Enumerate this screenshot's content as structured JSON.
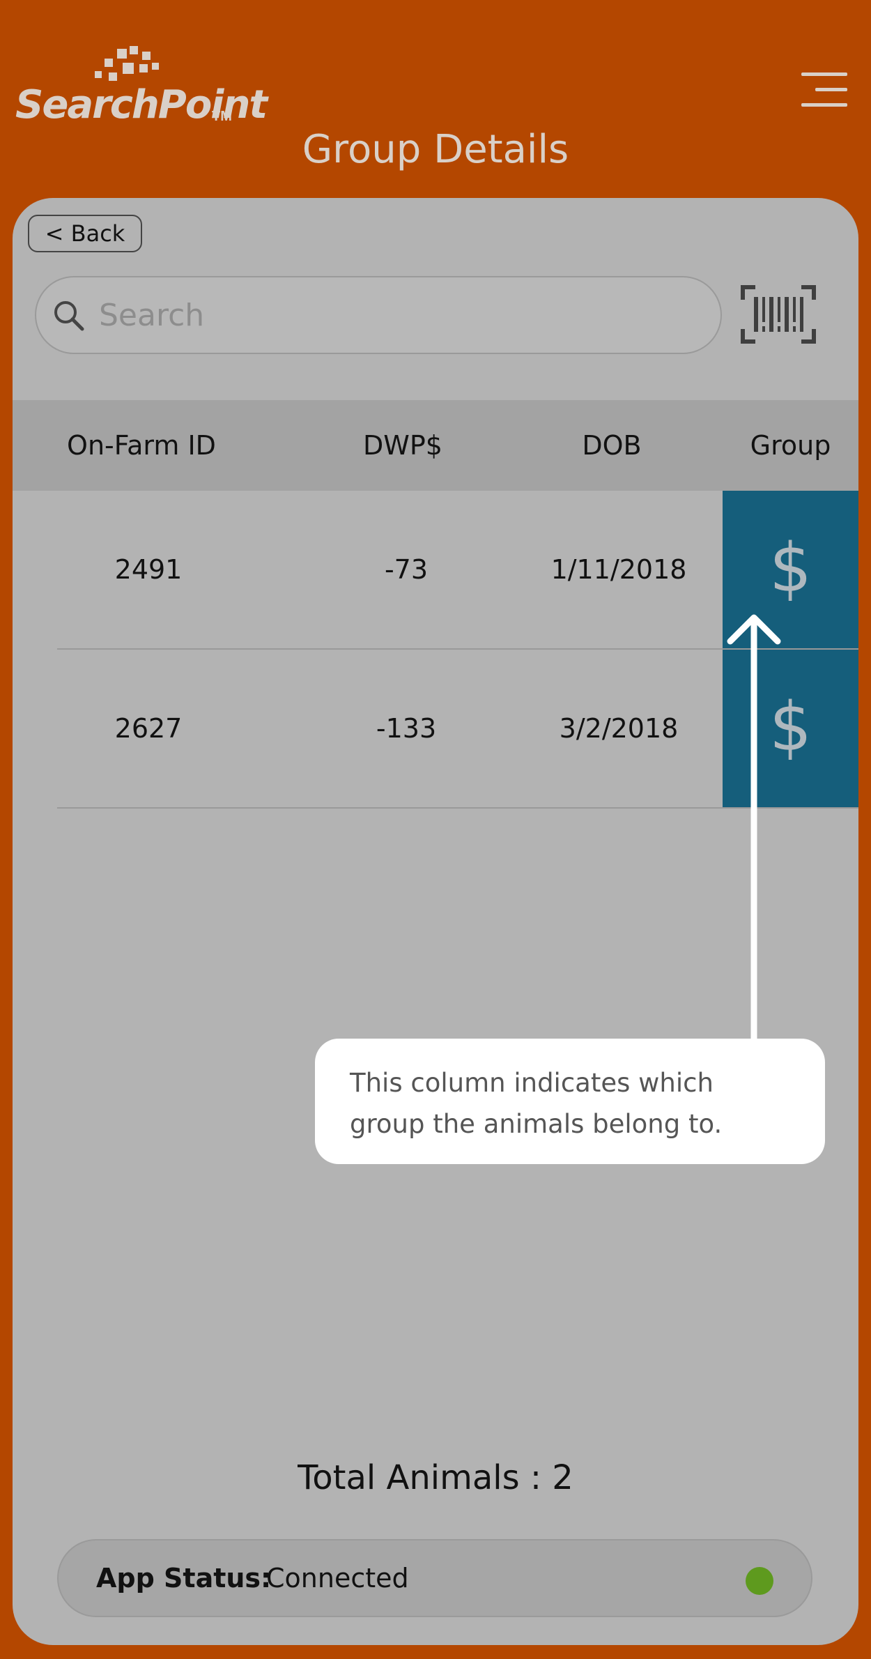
{
  "brand": {
    "logo_text": "SearchPoint",
    "logo_tm": "TM"
  },
  "header": {
    "title": "Group Details"
  },
  "toolbar": {
    "back_label": "< Back",
    "search_placeholder": "Search"
  },
  "table": {
    "columns": [
      "On-Farm ID",
      "DWP$",
      "DOB",
      "Group"
    ],
    "rows": [
      {
        "on_farm_id": "2491",
        "dwp": "-73",
        "dob": "1/11/2018",
        "group": "$"
      },
      {
        "on_farm_id": "2627",
        "dwp": "-133",
        "dob": "3/2/2018",
        "group": "$"
      }
    ]
  },
  "annotation": {
    "text": "This column indicates which group the animals belong to."
  },
  "footer": {
    "total_animals": "Total Animals : 2",
    "status_label": "App Status:",
    "status_value": "Connected",
    "status_color": "#5E9A1E"
  },
  "colors": {
    "header_bg": "#B44700",
    "card_bg": "#B3B3B3",
    "group_cell": "#155E7B"
  },
  "icons": [
    "menu-icon",
    "search-icon",
    "barcode-icon",
    "arrow-up-icon",
    "status-dot-icon"
  ]
}
